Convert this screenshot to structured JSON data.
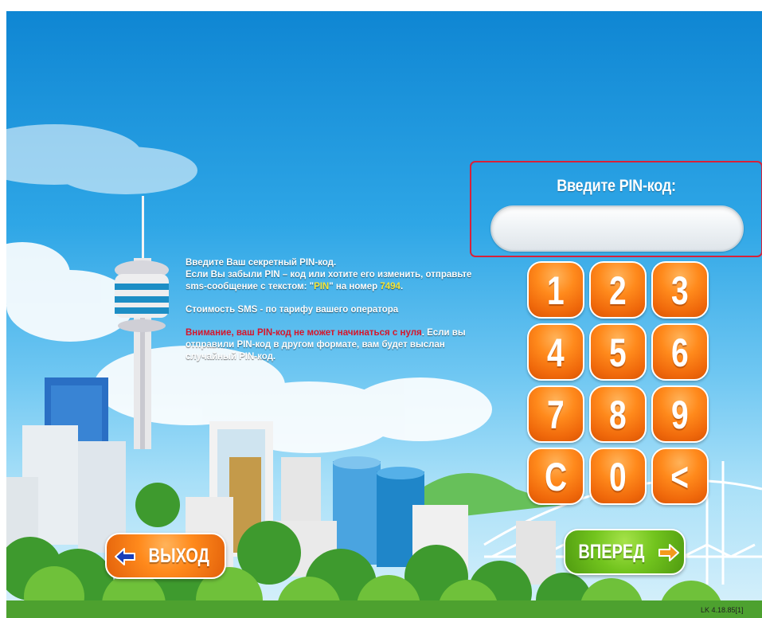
{
  "pin": {
    "title": "Введите PIN-код:",
    "value": ""
  },
  "info": {
    "line1": "Введите Ваш секретный PIN-код.",
    "line2_prefix": " Если Вы забыли PIN – код или хотите его изменить, отправьте sms-сообщение с текстом: \"",
    "sms_text": "PIN",
    "line2_mid": "\" на номер ",
    "sms_number": "7494",
    "line2_suffix": ".",
    "cost": "Стоимость SMS - по тарифу вашего оператора",
    "warning": "Внимание, ваш PIN-код не может начинаться с нуля",
    "warning_rest": ". Если вы отправили PIN-код в другом формате, вам будет выслан случайный PIN-код."
  },
  "keypad": {
    "keys": [
      "1",
      "2",
      "3",
      "4",
      "5",
      "6",
      "7",
      "8",
      "9",
      "C",
      "0",
      "<"
    ]
  },
  "buttons": {
    "exit_label": "ВЫХОД",
    "next_label": "ВПЕРЕД"
  },
  "version": "LK 4.18.85[1]",
  "colors": {
    "key_orange": "#f0690b",
    "next_green": "#72c41e",
    "pin_frame_red": "#d7223a",
    "sms_highlight": "#f5e63a",
    "warning_red": "#d6152a"
  }
}
